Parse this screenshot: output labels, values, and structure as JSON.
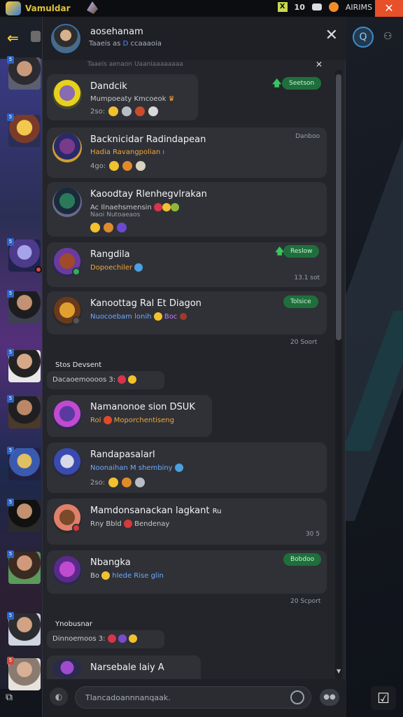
{
  "statusbar": {
    "title": "Vamuldar",
    "clock": "10",
    "brand": "AIRIMS",
    "close": "✕"
  },
  "header": {
    "name": "aosehanam",
    "sub_prefix": "Taaeis as",
    "sub_link": "D",
    "sub_suffix": "ccaaaoia",
    "close": "✕",
    "subline": "Taaeis aenaon  Uaaniaaaaaaaa"
  },
  "messages": [
    {
      "name": "Dandcik",
      "line": "Mumpoeaty Kmcoeok",
      "reacts_prefix": "2so:",
      "time": "",
      "pill": "Seetson"
    },
    {
      "name": "Backnicidar Radindapean",
      "line": "Hadia Ravangpolian",
      "reacts_prefix": "4go:",
      "time": "Danboo",
      "pill": ""
    },
    {
      "name": "Kaoodtay Rlenhegvlrakan",
      "line": "Ac Ilnaehsmensin",
      "line2": "Naoi Nutoaeaos",
      "reacts_prefix": "",
      "time": "",
      "pill": ""
    },
    {
      "name": "Rangdila",
      "line": "Dopoechiler",
      "reacts_prefix": "",
      "time": "13.1 sot",
      "pill": "Reslow"
    },
    {
      "name": "Kanoottag Ral Et Diagon",
      "line": "Nuocoebam lonih",
      "line_extra": "Boc",
      "reacts_prefix": "",
      "time": "",
      "pill": "Tolsice"
    },
    {
      "name": "Namanonoe sion DSUK",
      "line": "Rol",
      "line_extra": "Moporchentiseng",
      "reacts_prefix": "",
      "time": "",
      "pill": ""
    },
    {
      "name": "Randapasalarl",
      "line": "Noonaihan M shembiny",
      "reacts_prefix": "2so:",
      "time": "",
      "pill": ""
    },
    {
      "name": "Mamdonsanackan lagkant",
      "line": "Rny Bbld",
      "line_extra": "Bendenay",
      "reacts_prefix": "",
      "time": "30 5",
      "pill": ""
    },
    {
      "name": "Nbangka",
      "line": "Bo",
      "line_extra": "hlede Rise glin",
      "reacts_prefix": "",
      "time": "",
      "pill": "Bobdoo"
    },
    {
      "name": "Narsebale laiy A",
      "line": "",
      "reacts_prefix": "",
      "time": "",
      "pill": ""
    }
  ],
  "labels": {
    "sec1": "Stos Devsent",
    "sys1": "Dacaoemoooos 3:",
    "stamp1": "20 Soort",
    "stamp2": "20 Scport",
    "sec2": "Ynobusnar",
    "sys2": "Dinnoemoos 3:",
    "msg_extra": "Ru"
  },
  "input": {
    "placeholder": "Tlancadoannnanqaak."
  },
  "colors": {
    "accent": "#3b6fa0",
    "pill_green": "#1f6f3c",
    "panel": "#23252b",
    "card": "#2f3137"
  }
}
